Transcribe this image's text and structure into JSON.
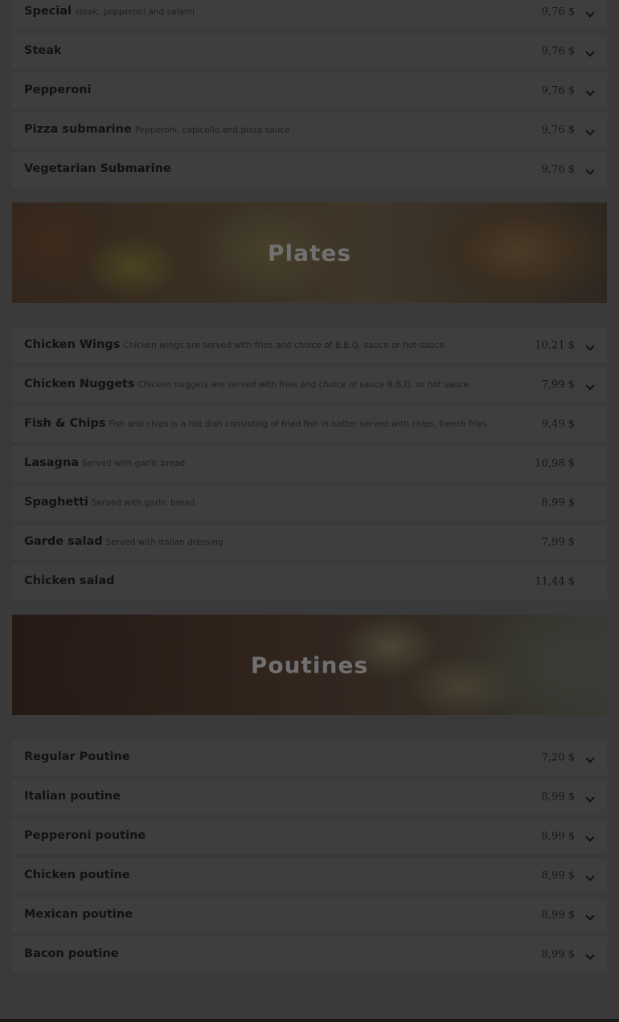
{
  "submarines": {
    "items": [
      {
        "name": "Special",
        "desc": "steak, pepperoni and salami",
        "price": "9,76 $"
      },
      {
        "name": "Steak",
        "desc": "",
        "price": "9,76 $"
      },
      {
        "name": "Pepperoni",
        "desc": "",
        "price": "9,76 $"
      },
      {
        "name": "Pizza submarine",
        "desc": "Pepperoni, capicollo and pizza sauce",
        "price": "9,76 $"
      },
      {
        "name": "Vegetarian Submarine",
        "desc": "",
        "price": "9,76 $"
      }
    ]
  },
  "plates": {
    "title": "Plates",
    "items": [
      {
        "name": "Chicken Wings",
        "desc": "Chicken wings are served with fries and choice of B.B.Q. sauce or hot-sauce.",
        "price": "10,21 $"
      },
      {
        "name": "Chicken Nuggets",
        "desc": "Chicken nuggets are served with fries and choice of sauce B.B.Q. or hot sauce.",
        "price": "7,99 $"
      },
      {
        "name": "Fish & Chips",
        "desc": "Fish and chips is a hot dish consisting of fried fish in batter served with chips, french fries.",
        "price": "9,49 $"
      },
      {
        "name": "Lasagna",
        "desc": "Served with garlic bread",
        "price": "10,98 $"
      },
      {
        "name": "Spaghetti",
        "desc": "Served with garlic bread",
        "price": "8,99 $"
      },
      {
        "name": "Garde salad",
        "desc": "Served with italian dressing",
        "price": "7,99 $"
      },
      {
        "name": "Chicken salad",
        "desc": "",
        "price": "11,44 $"
      }
    ]
  },
  "poutines": {
    "title": "Poutines",
    "items": [
      {
        "name": "Regular Poutine",
        "desc": "",
        "price": "7,20 $"
      },
      {
        "name": "Italian poutine",
        "desc": "",
        "price": "8,99 $"
      },
      {
        "name": "Pepperoni poutine",
        "desc": "",
        "price": "8,99 $"
      },
      {
        "name": "Chicken poutine",
        "desc": "",
        "price": "8,99 $"
      },
      {
        "name": "Mexican poutine",
        "desc": "",
        "price": "8,99 $"
      },
      {
        "name": "Bacon poutine",
        "desc": "",
        "price": "8,99 $"
      }
    ]
  },
  "icons": {
    "expand": "chevron-down-icon"
  }
}
